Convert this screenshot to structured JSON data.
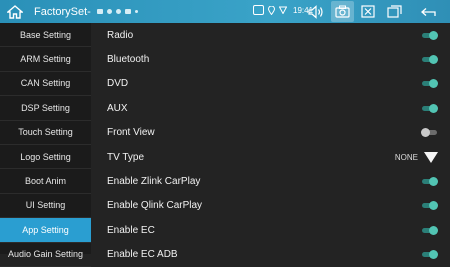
{
  "header": {
    "title": "FactorySet-",
    "time": "19:41"
  },
  "sidebar": {
    "items": [
      {
        "label": "Base Setting",
        "active": false
      },
      {
        "label": "ARM Setting",
        "active": false
      },
      {
        "label": "CAN Setting",
        "active": false
      },
      {
        "label": "DSP Setting",
        "active": false
      },
      {
        "label": "Touch Setting",
        "active": false
      },
      {
        "label": "Logo Setting",
        "active": false
      },
      {
        "label": "Boot Anim",
        "active": false
      },
      {
        "label": "UI Setting",
        "active": false
      },
      {
        "label": "App Setting",
        "active": true
      },
      {
        "label": "Audio Gain Setting",
        "active": false
      }
    ]
  },
  "main": {
    "rows": [
      {
        "label": "Radio",
        "type": "toggle",
        "on": true
      },
      {
        "label": "Bluetooth",
        "type": "toggle",
        "on": true
      },
      {
        "label": "DVD",
        "type": "toggle",
        "on": true
      },
      {
        "label": "AUX",
        "type": "toggle",
        "on": true
      },
      {
        "label": "Front View",
        "type": "toggle",
        "on": false
      },
      {
        "label": "TV Type",
        "type": "select",
        "value": "NONE"
      },
      {
        "label": "Enable Zlink CarPlay",
        "type": "toggle",
        "on": true
      },
      {
        "label": "Enable Qlink CarPlay",
        "type": "toggle",
        "on": true
      },
      {
        "label": "Enable EC",
        "type": "toggle",
        "on": true
      },
      {
        "label": "Enable EC ADB",
        "type": "toggle",
        "on": true
      }
    ]
  },
  "colors": {
    "accent": "#2a9ed1",
    "toggle_on": "#52c4b3",
    "toggle_off": "#c9c9c9"
  }
}
